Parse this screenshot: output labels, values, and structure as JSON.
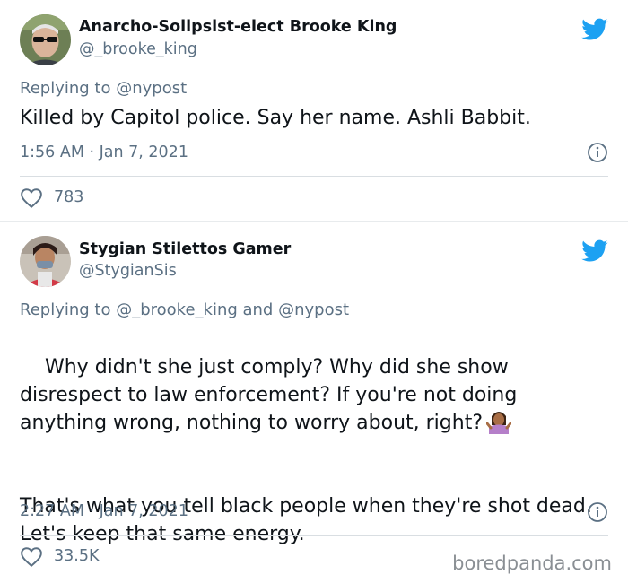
{
  "tweets": [
    {
      "display_name": "Anarcho-Solipsist-elect Brooke King",
      "handle": "@_brooke_king",
      "replying_prefix": "Replying to ",
      "replying_to": "@nypost",
      "text": "Killed by Capitol police. Say her name. Ashli Babbit.",
      "timestamp": "1:56 AM · Jan 7, 2021",
      "likes": "783"
    },
    {
      "display_name": "Stygian Stilettos Gamer",
      "handle": "@StygianSis",
      "replying_prefix": "Replying to ",
      "replying_to": "@_brooke_king and @nypost",
      "text_line1": "Why didn't she just comply? Why did she show disrespect to law enforcement? If you're not doing anything wrong, nothing to worry about, right?",
      "text_line2": "That's what you tell black people when they're shot dead. Let's keep that same energy.",
      "timestamp": "2:27 AM · Jan 7, 2021",
      "likes": "33.5K"
    }
  ],
  "icons": {
    "brand": "twitter-bird-icon",
    "info": "info-icon",
    "like": "heart-icon",
    "emoji": "person-shrugging-emoji"
  },
  "colors": {
    "twitter_blue": "#1da1f2",
    "secondary_text": "#5b7083",
    "primary_text": "#0f1419"
  },
  "watermark": "boredpanda.com"
}
